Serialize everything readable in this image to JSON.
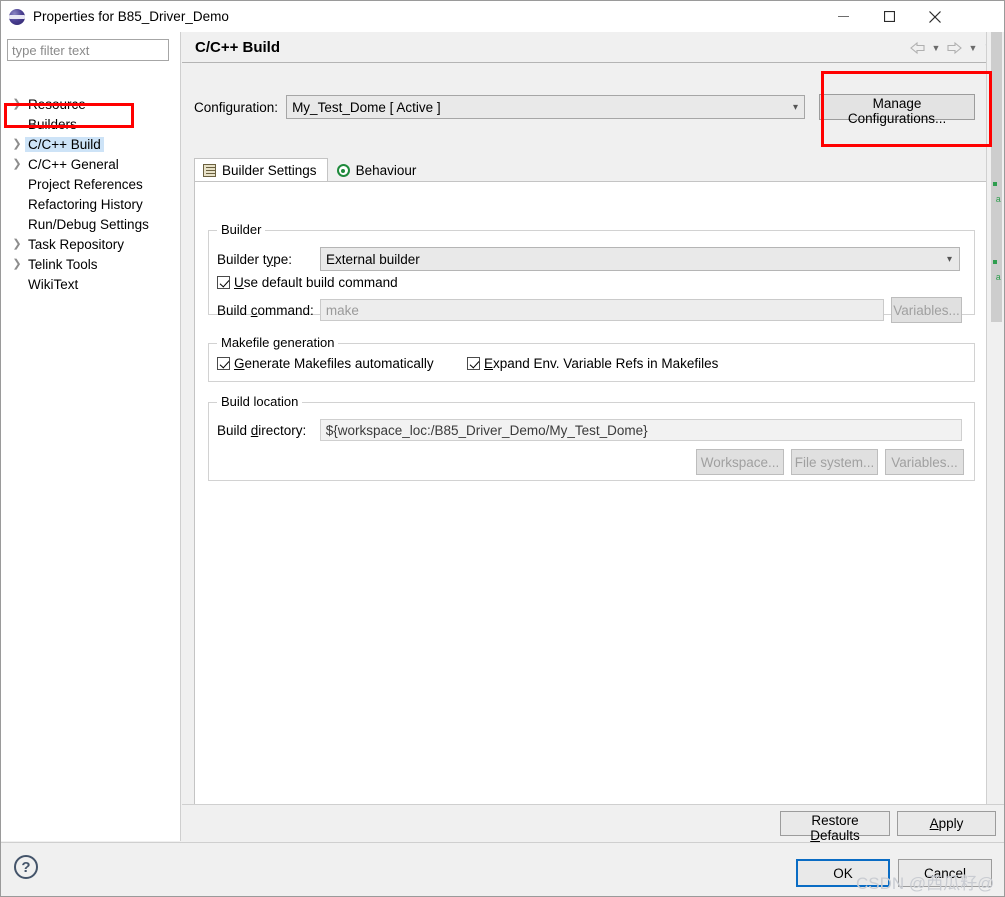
{
  "window": {
    "title": "Properties for B85_Driver_Demo",
    "icon": "eclipse-sphere-icon",
    "controls": {
      "minimize": "—",
      "maximize": "☐",
      "close": "✕"
    }
  },
  "sidebar": {
    "filter": {
      "placeholder": "type filter text",
      "value": ""
    },
    "items": [
      {
        "label": "Resource",
        "expandable": true,
        "selected": false
      },
      {
        "label": "Builders",
        "expandable": false,
        "selected": false
      },
      {
        "label": "C/C++ Build",
        "expandable": true,
        "selected": true
      },
      {
        "label": "C/C++ General",
        "expandable": true,
        "selected": false
      },
      {
        "label": "Project References",
        "expandable": false,
        "selected": false
      },
      {
        "label": "Refactoring History",
        "expandable": false,
        "selected": false
      },
      {
        "label": "Run/Debug Settings",
        "expandable": false,
        "selected": false
      },
      {
        "label": "Task Repository",
        "expandable": true,
        "selected": false
      },
      {
        "label": "Telink Tools",
        "expandable": true,
        "selected": false
      },
      {
        "label": "WikiText",
        "expandable": false,
        "selected": false
      }
    ]
  },
  "page": {
    "title": "C/C++ Build",
    "nav": {
      "back": "back-arrow-icon",
      "back_menu": "chevron-down-icon",
      "forward": "forward-arrow-icon",
      "forward_menu": "chevron-down-icon",
      "view_menu": "chevron-down-icon"
    }
  },
  "configuration": {
    "label": "Configuration:",
    "value": "My_Test_Dome  [ Active ]",
    "caret": "∨",
    "manage_button": "Manage Configurations..."
  },
  "tabs": [
    {
      "label": "Builder Settings",
      "icon": "list-settings-icon",
      "active": true
    },
    {
      "label": "Behaviour",
      "icon": "target-circle-icon",
      "active": false
    }
  ],
  "builder_group": {
    "title": "Builder",
    "builder_type_label": "Builder type:",
    "builder_type_value": "External builder",
    "caret": "∨",
    "use_default_checkbox": {
      "label_pre": "U",
      "label_rest": "se default build command",
      "checked": true
    },
    "build_command_label_pre": "Build ",
    "build_command_label_key": "c",
    "build_command_label_rest": "ommand:",
    "build_command_value": "make",
    "variables_button": "Variables..."
  },
  "makefile_group": {
    "title": "Makefile generation",
    "generate_checkbox": {
      "label_pre": "G",
      "label_rest": "enerate Makefiles automatically",
      "checked": true
    },
    "expand_checkbox": {
      "label_pre": "E",
      "label_rest": "xpand Env. Variable Refs in Makefiles",
      "checked": true
    }
  },
  "build_location_group": {
    "title": "Build location",
    "directory_label_pre": "Build ",
    "directory_label_key": "d",
    "directory_label_rest": "irectory:",
    "directory_value": "${workspace_loc:/B85_Driver_Demo/My_Test_Dome}",
    "workspace_button": "Workspace...",
    "filesystem_button": "File system...",
    "variables_button": "Variables..."
  },
  "footer": {
    "restore_defaults_pre": "Restore ",
    "restore_defaults_key": "D",
    "restore_defaults_rest": "efaults",
    "apply_key": "A",
    "apply_rest": "pply",
    "ok": "OK",
    "cancel": "Cancel",
    "help_icon": "?"
  },
  "annotations": {
    "highlight_color": "#ff0000",
    "boxes": [
      "sidebar-c-cpp-build",
      "manage-configurations-button"
    ]
  },
  "watermark": "CSDN @西瓜籽@"
}
